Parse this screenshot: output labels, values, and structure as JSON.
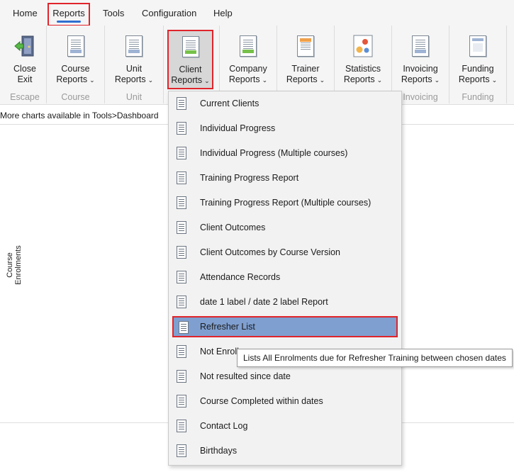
{
  "menu": {
    "tabs": [
      "Home",
      "Reports",
      "Tools",
      "Configuration",
      "Help"
    ]
  },
  "ribbon": {
    "groups": [
      {
        "caption": "Escape",
        "button": {
          "line1": "Close",
          "line2": "Exit",
          "icon": "exit-door-icon"
        }
      },
      {
        "caption": "Course",
        "button": {
          "line1": "Course",
          "line2": "Reports",
          "icon": "report-icon"
        }
      },
      {
        "caption": "Unit",
        "button": {
          "line1": "Unit",
          "line2": "Reports",
          "icon": "report-icon"
        }
      },
      {
        "caption": "",
        "button": {
          "line1": "Client",
          "line2": "Reports",
          "icon": "report-green-icon"
        }
      },
      {
        "caption": "",
        "button": {
          "line1": "Company",
          "line2": "Reports",
          "icon": "report-green-icon"
        }
      },
      {
        "caption": "",
        "button": {
          "line1": "Trainer",
          "line2": "Reports",
          "icon": "report-orange-icon"
        }
      },
      {
        "caption": "",
        "button": {
          "line1": "Statistics",
          "line2": "Reports",
          "icon": "statistics-icon"
        }
      },
      {
        "caption": "Invoicing",
        "button": {
          "line1": "Invoicing",
          "line2": "Reports",
          "icon": "report-icon"
        }
      },
      {
        "caption": "Funding",
        "button": {
          "line1": "Funding",
          "line2": "Reports",
          "icon": "report-icon"
        }
      }
    ]
  },
  "info_text": "More charts available in Tools>Dashboard",
  "chart": {
    "y_label": "Course Enrolments"
  },
  "dropdown": {
    "items": [
      "Current Clients",
      "Individual Progress",
      "Individual Progress (Multiple courses)",
      "Training Progress Report",
      "Training Progress Report (Multiple courses)",
      "Client Outcomes",
      "Client Outcomes by Course Version",
      "Attendance Records",
      "date 1 label / date 2 label Report",
      "Refresher List",
      "Not Enroll",
      "Not resulted since date",
      "Course Completed within dates",
      "Contact Log",
      "Birthdays"
    ],
    "selected": "Refresher List"
  },
  "tooltip": "Lists All Enrolments due for Refresher Training between chosen dates",
  "colors": {
    "highlight_border": "#e0242b",
    "selection": "#7f9fd0",
    "accent_underline": "#2f6fd1"
  }
}
